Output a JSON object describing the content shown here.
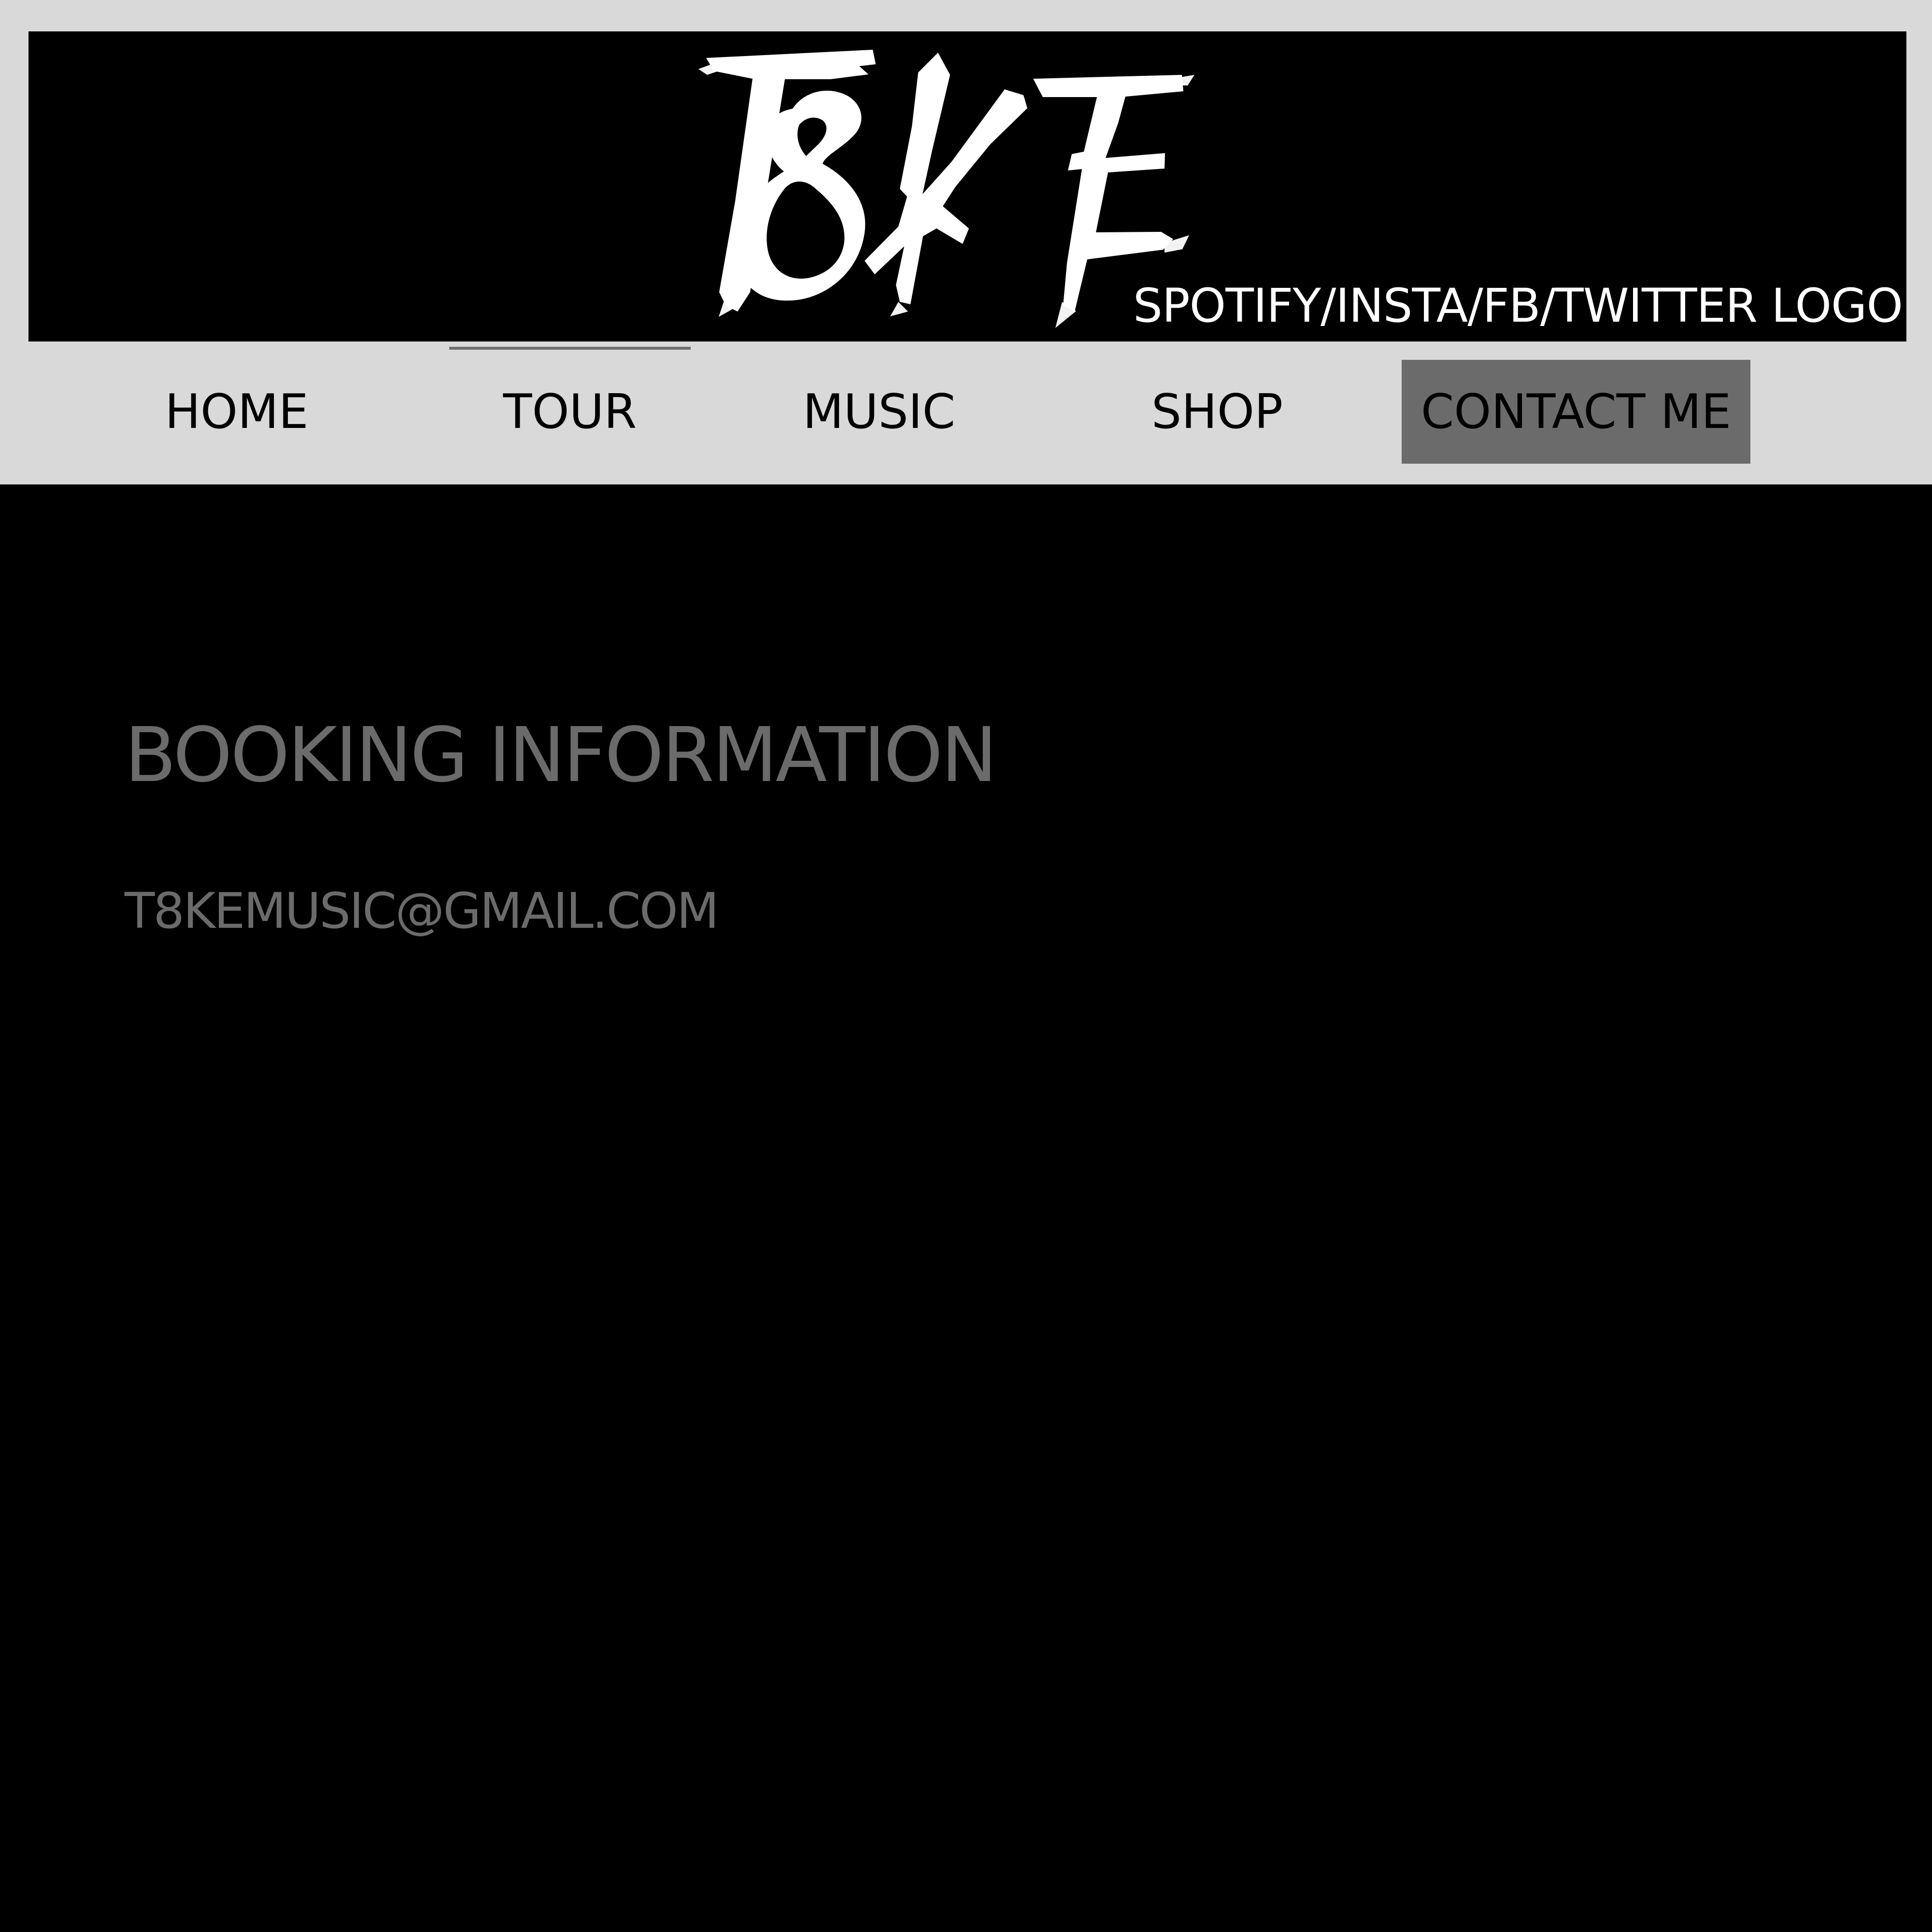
{
  "header": {
    "logo_text": "T8KE",
    "social_label": "SPOTIFY/INSTA/FB/TWITTER LOGO"
  },
  "nav": {
    "items": [
      {
        "label": "HOME"
      },
      {
        "label": "TOUR"
      },
      {
        "label": "MUSIC"
      },
      {
        "label": "SHOP"
      },
      {
        "label": "CONTACT ME"
      }
    ],
    "active_item": "CONTACT ME"
  },
  "content": {
    "heading": "BOOKING INFORMATION",
    "email": "T8KEMUSIC@GMAIL.COM"
  },
  "colors": {
    "top_background": "#d9d9d9",
    "banner_background": "#000000",
    "page_background": "#000000",
    "logo": "#ffffff",
    "nav_text": "#000000",
    "active_nav_background": "#6b6b6b",
    "content_text": "#6b6b6b"
  }
}
